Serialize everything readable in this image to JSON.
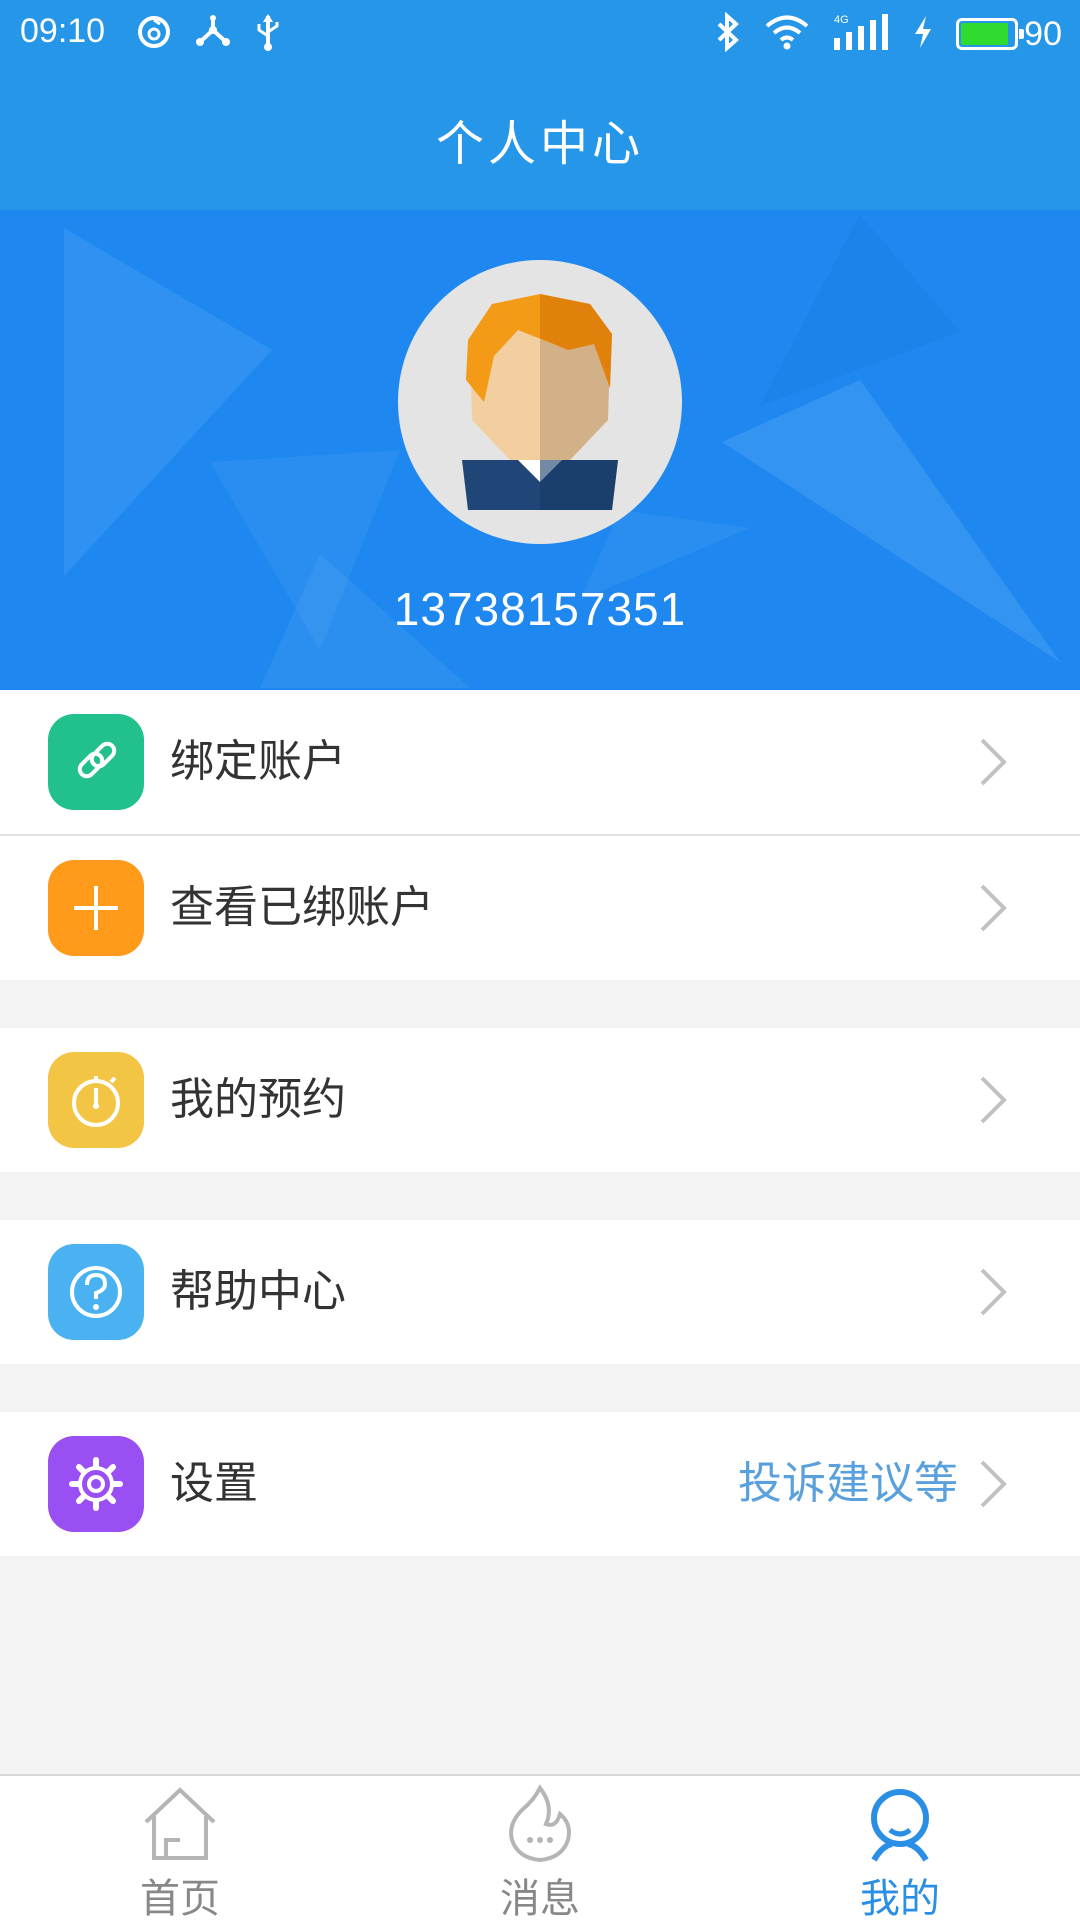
{
  "status_bar": {
    "time": "09:10",
    "network": "4G",
    "battery_level": "90",
    "battery_fraction": 0.9,
    "icons": [
      "netease-music-icon",
      "share-hub-icon",
      "usb-icon",
      "bluetooth-icon",
      "wifi-icon",
      "signal-icon",
      "charging-icon",
      "battery-icon"
    ]
  },
  "header": {
    "title": "个人中心"
  },
  "profile": {
    "phone": "13738157351",
    "avatar": "male-avatar-icon"
  },
  "menu": [
    {
      "id": "bind-account",
      "label": "绑定账户",
      "icon": "link-icon",
      "color": "#21c08c"
    },
    {
      "id": "view-bound",
      "label": "查看已绑账户",
      "icon": "plus-icon",
      "color": "#ff9a1a"
    },
    {
      "id": "my-reservations",
      "label": "我的预约",
      "icon": "stopwatch-icon",
      "color": "#f2c544"
    },
    {
      "id": "help-center",
      "label": "帮助中心",
      "icon": "question-icon",
      "color": "#4ab2f0"
    },
    {
      "id": "settings",
      "label": "设置",
      "icon": "gear-icon",
      "color": "#9a4ff2",
      "hint": "投诉建议等"
    }
  ],
  "bottom_nav": [
    {
      "label": "首页",
      "icon": "home-icon",
      "active": false
    },
    {
      "label": "消息",
      "icon": "message-flame-icon",
      "active": false
    },
    {
      "label": "我的",
      "icon": "user-icon",
      "active": true
    }
  ],
  "colors": {
    "primary": "#2596e8",
    "header_bg": "#1e88f0",
    "active_tab": "#2a8ee4",
    "hint_text": "#5aa0dc"
  }
}
